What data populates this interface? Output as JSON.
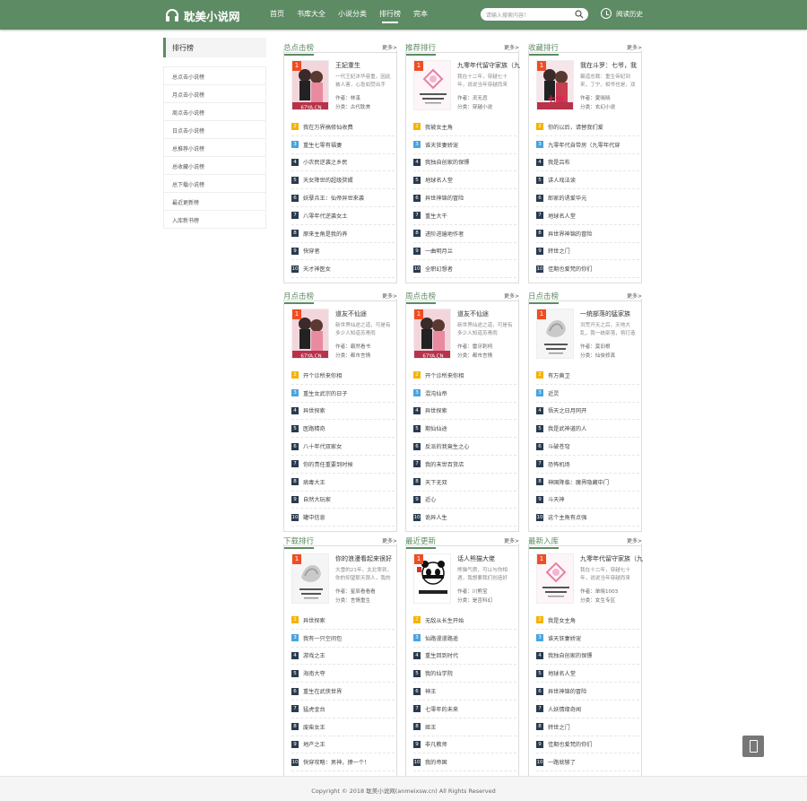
{
  "header": {
    "logo_text": "耽美小说网",
    "nav": [
      "首页",
      "书库大全",
      "小说分类",
      "排行榜",
      "完本"
    ],
    "active_nav": 3,
    "search_placeholder": "请输入搜索内容！",
    "record_label": "阅读历史"
  },
  "colors": {
    "theme": "#5d8b63",
    "rank1": "#f04d22",
    "rank2": "#f5b300",
    "rank3": "#4aa3df",
    "rankN": "#2a3b4e"
  },
  "sidebar": {
    "title": "排行榜",
    "items": [
      "总点击小说榜",
      "月点击小说榜",
      "周点击小说榜",
      "日点击小说榜",
      "总推荐小说榜",
      "总收藏小说榜",
      "总下载小说榜",
      "最近更新榜",
      "入库新书榜"
    ]
  },
  "boxes": [
    {
      "title": "总点击榜",
      "more": "更多>",
      "top": {
        "name": "王妃重生",
        "desc": "一代王妃沐华容重，因此被人害，心急如焚出手",
        "author": "作者：林溪",
        "category": "分类：古代耽美",
        "cover_text": "67YA.CN",
        "cover": "girl"
      },
      "list": [
        "我在万界搞修仙收费",
        "重生七零有福妻",
        "小农民逆袭之乡民",
        "天女降世的超级赘婿",
        "妖孽兵王：仙帝异世来袭",
        "八零年代逆袭女土",
        "原来主角是我的养",
        "快穿者",
        "天才神医女"
      ]
    },
    {
      "title": "推荐排行",
      "more": "更多>",
      "top": {
        "name": "九零年代留守家族（九",
        "desc": "我在十二年，穿越七十年，说说当年穿越而来",
        "author": "作者：灵无忌",
        "category": "分类：穿越小说",
        "cover_text": "九零年代留守家族",
        "cover": "pink"
      },
      "list": [
        "我被女主角",
        "谁天狂妻娇宠",
        "我独自创家的保镖",
        "地球名人堂",
        "异世神锦的冒险",
        "重生大干",
        "进阶进遍地作者",
        "一曲明月兰",
        "全职幻想者"
      ]
    },
    {
      "title": "收藏排行",
      "more": "更多>",
      "top": {
        "name": "我在斗罗：七爷，我",
        "desc": "霸道总裁：重生帝妃到来，丁宁，相爷也是，双子爱情",
        "author": "作者：夏晓晓",
        "category": "分类：玄幻小说",
        "cover_text": "七爷 惹着咨",
        "cover": "redgirl"
      },
      "list": [
        "你的以后，请替我们爱",
        "九零年代自带房（九零年代穿",
        "我是吕布",
        "讲人戏法读",
        "郎家的诱爱华元",
        "地球名人堂",
        "异世界神锦的冒险",
        "转世之门",
        "佳期也爱梵的你们"
      ]
    },
    {
      "title": "月点击榜",
      "more": "更多>",
      "top": {
        "name": "道友不仙途",
        "desc": "新世界仙途之道，可是有多少人知道苏青雨",
        "author": "作者：霸然看书",
        "category": "分类：都市言情",
        "cover_text": "67YA.CN",
        "cover": "girl"
      },
      "list": [
        "开个诊所来你相",
        "重生女武宗的日子",
        "异世探索",
        "医路精奇",
        "八十年代双家女",
        "你的责任重要到时候",
        "病毒大王",
        "自然大玩家",
        "罐中信息"
      ]
    },
    {
      "title": "周点击榜",
      "more": "更多>",
      "top": {
        "name": "道友不仙途",
        "desc": "新世界仙途之道，可是有多少人知道苏青雨",
        "author": "作者：雷牙刺柯",
        "category": "分类：都市言情",
        "cover_text": "67YA.CN",
        "cover": "girl"
      },
      "list": [
        "开个诊所来你相",
        "混沌仙帝",
        "异世探索",
        "期仙仙途",
        "反派的我竟生之心",
        "我的末世百货店",
        "天下无双",
        "近心",
        "诡异人生"
      ]
    },
    {
      "title": "日点击榜",
      "more": "更多>",
      "top": {
        "name": "一统部落的猛家族",
        "desc": "洪荒开天之后，天地大乱，我一统部落，将打造",
        "author": "作者：莫旧根",
        "category": "分类：仙侠修真",
        "cover_text": "一统部落 猛家族",
        "cover": "grey"
      },
      "list": [
        "有万兽卫",
        "近灵",
        "悟天之日月同开",
        "我是武神道的人",
        "斗破苍穹",
        "恐怖机场",
        "神国降临：魔界隐藏中门",
        "斗天神",
        "这个主角有点强"
      ]
    },
    {
      "title": "下载排行",
      "more": "更多>",
      "top": {
        "name": "你的浪漫看起来很好",
        "desc": "大雪的21年，太北零到，你的仰望那天那人，我的我人，之间",
        "author": "作者：星辰看看看",
        "category": "分类：言情重生",
        "cover_text": "你的浪漫看起来很好",
        "cover": "grey"
      },
      "list": [
        "异世探索",
        "我有一只空间包",
        "游戏之王",
        "海南大夺",
        "重生在武侠世界",
        "猛虎金台",
        "废柴女王",
        "地产之王",
        "快穿攻略：男神，撩一个！"
      ]
    },
    {
      "title": "最近更新",
      "more": "更多>",
      "top": {
        "name": "话人熊猫大佬",
        "desc": "熊猫气质，可以与你相遇，我想要我们创造好",
        "author": "作者：川熊宝",
        "category": "分类：是否科幻",
        "cover_text": "话人熊猫大佬",
        "cover": "panda"
      },
      "list": [
        "无敌从长生开始",
        "仙路漫漫路遥",
        "重生回到时代",
        "我的仙学院",
        "神王",
        "七零年的未来",
        "姬王",
        "非凡教师",
        "我的帝国"
      ]
    },
    {
      "title": "最新入库",
      "more": "更多>",
      "top": {
        "name": "九零年代留守家族（九",
        "desc": "我在十二年，穿越七十年，说说当年穿越而来",
        "author": "作者：单晓1003",
        "category": "分类：女生专区",
        "cover_text": "九零年代留守家族",
        "cover": "pink"
      },
      "list": [
        "我是女主角",
        "谁天狂妻娇宠",
        "我独自创家的保镖",
        "地球名人堂",
        "异世神锦的冒险",
        "人妖情缘奇闻",
        "转世之门",
        "佳期也爱梵的你们",
        "一路就够了"
      ]
    }
  ],
  "footer": "Copyright © 2018 耽美小说网(anmeixsw.cn) All Rights Reserved"
}
